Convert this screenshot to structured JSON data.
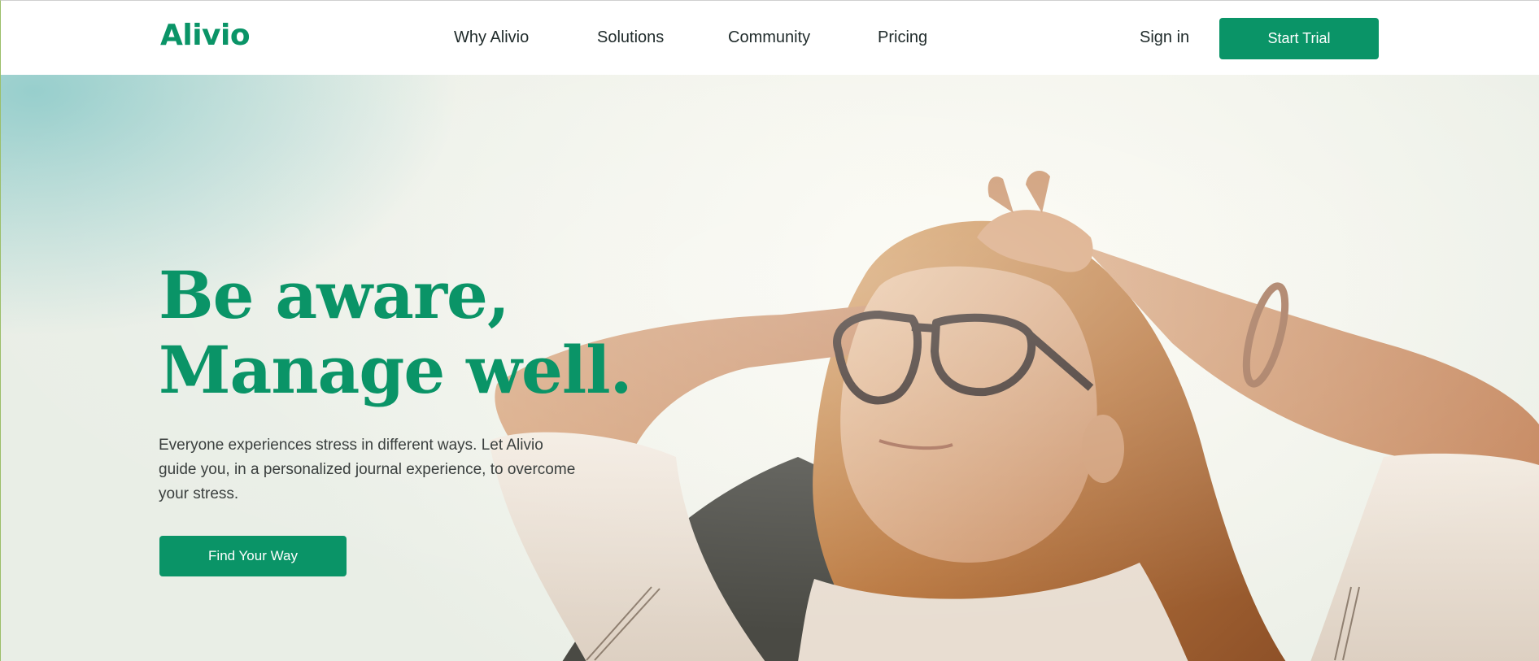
{
  "brand": {
    "name": "Alivio",
    "color": "#0a9467"
  },
  "nav": {
    "items": [
      {
        "label": "Why Alivio"
      },
      {
        "label": "Solutions"
      },
      {
        "label": "Community"
      },
      {
        "label": "Pricing"
      }
    ],
    "sign_in": "Sign in",
    "cta": "Start Trial"
  },
  "hero": {
    "headline_line1": "Be aware,",
    "headline_line2": "Manage well.",
    "body": "Everyone experiences stress in different ways. Let Alivio guide you, in a personalized journal experience, to overcome your stress.",
    "cta": "Find Your Way",
    "photo": "woman-with-glasses-eyes-closed-sunlight"
  }
}
